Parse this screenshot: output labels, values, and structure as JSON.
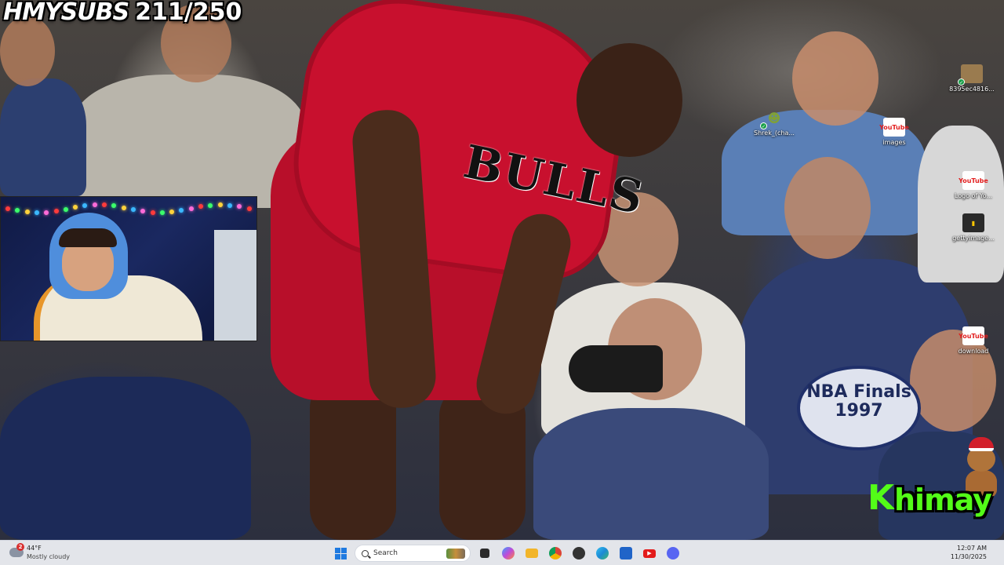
{
  "overlay": {
    "brand": "HMYSUBS",
    "counter": "211/250"
  },
  "wallpaper": {
    "jersey_text": "BULLS",
    "finals_logo": "NBA Finals 1997"
  },
  "desktop_icons": [
    {
      "label": "8395ec4816...",
      "icon": "image-file-icon"
    },
    {
      "label": "Shrek_(cha...",
      "icon": "shrek-file-icon"
    },
    {
      "label": "images",
      "icon": "youtube-file-icon",
      "glyph": "YouTube"
    },
    {
      "label": "Logo of Yo...",
      "icon": "youtube-file-icon",
      "glyph": "YouTube"
    },
    {
      "label": "gettyimage...",
      "icon": "image-file-icon"
    },
    {
      "label": "download",
      "icon": "youtube-file-icon",
      "glyph": "YouTube"
    }
  ],
  "stream_logo": {
    "kick_glyph": "K",
    "name": "himay"
  },
  "taskbar": {
    "weather": {
      "badge": "2",
      "temperature": "44°F",
      "condition": "Mostly cloudy"
    },
    "search_placeholder": "Search",
    "apps": [
      {
        "name": "task-view",
        "color": "#2b2b2b"
      },
      {
        "name": "copilot",
        "color": "#6b5bd6"
      },
      {
        "name": "file-explorer",
        "color": "#f2b52a"
      },
      {
        "name": "chrome",
        "color": "#2c9a4b"
      },
      {
        "name": "media-app",
        "color": "#333333"
      },
      {
        "name": "edge",
        "color": "#1c8ad6"
      },
      {
        "name": "microsoft-store",
        "color": "#2064c8"
      },
      {
        "name": "youtube",
        "color": "#e31b1b"
      },
      {
        "name": "discord",
        "color": "#5865f2"
      }
    ],
    "clock": {
      "time": "12:07 AM",
      "date": "11/30/2025"
    }
  },
  "colors": {
    "taskbar_bg": "#eceef4",
    "kick_green": "#53fc18",
    "bulls_red": "#c8102e"
  }
}
